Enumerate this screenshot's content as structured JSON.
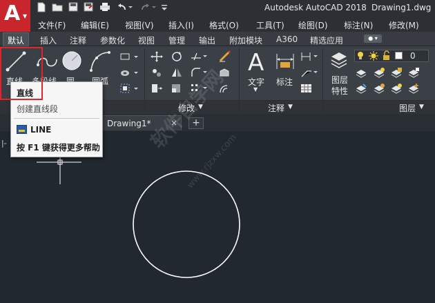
{
  "titlebar": {
    "app_title": "Autodesk AutoCAD 2018",
    "file_name": "Drawing1.dwg",
    "logo_letter": "A",
    "quick_access": [
      "new-icon",
      "open-icon",
      "save-icon",
      "save-as-icon",
      "print-icon",
      "undo-icon",
      "redo-icon",
      "more-icon"
    ]
  },
  "menubar": {
    "items": [
      "文件(F)",
      "编辑(E)",
      "视图(V)",
      "插入(I)",
      "格式(O)",
      "工具(T)",
      "绘图(D)",
      "标注(N)",
      "修改(M)"
    ]
  },
  "ribbon_tabs": {
    "items": [
      "默认",
      "插入",
      "注释",
      "参数化",
      "视图",
      "管理",
      "输出",
      "附加模块",
      "A360",
      "精选应用"
    ],
    "active": "默认"
  },
  "ribbon": {
    "draw_tools": [
      "直线",
      "多段线",
      "圆",
      "圆弧"
    ],
    "modify_title": "修改",
    "annotation_title": "注释",
    "annotation_tools": [
      "文字",
      "标注"
    ],
    "layers_title": "图层",
    "layer_properties": "图层\n特性",
    "layer_value": "0"
  },
  "document": {
    "tab_label": "Drawing1*",
    "close_glyph": "×",
    "add_glyph": "+",
    "wcs_mark": "|-"
  },
  "tooltip": {
    "title": "直线",
    "description": "创建直线段",
    "command": "LINE",
    "help": "按 F1 键获得更多帮助"
  },
  "watermark": {
    "text": "软件自学网",
    "url": "www.rjzxw.com"
  },
  "colors": {
    "highlight": "#e0262b",
    "logo": "#c9252c",
    "canvas": "#212830"
  }
}
